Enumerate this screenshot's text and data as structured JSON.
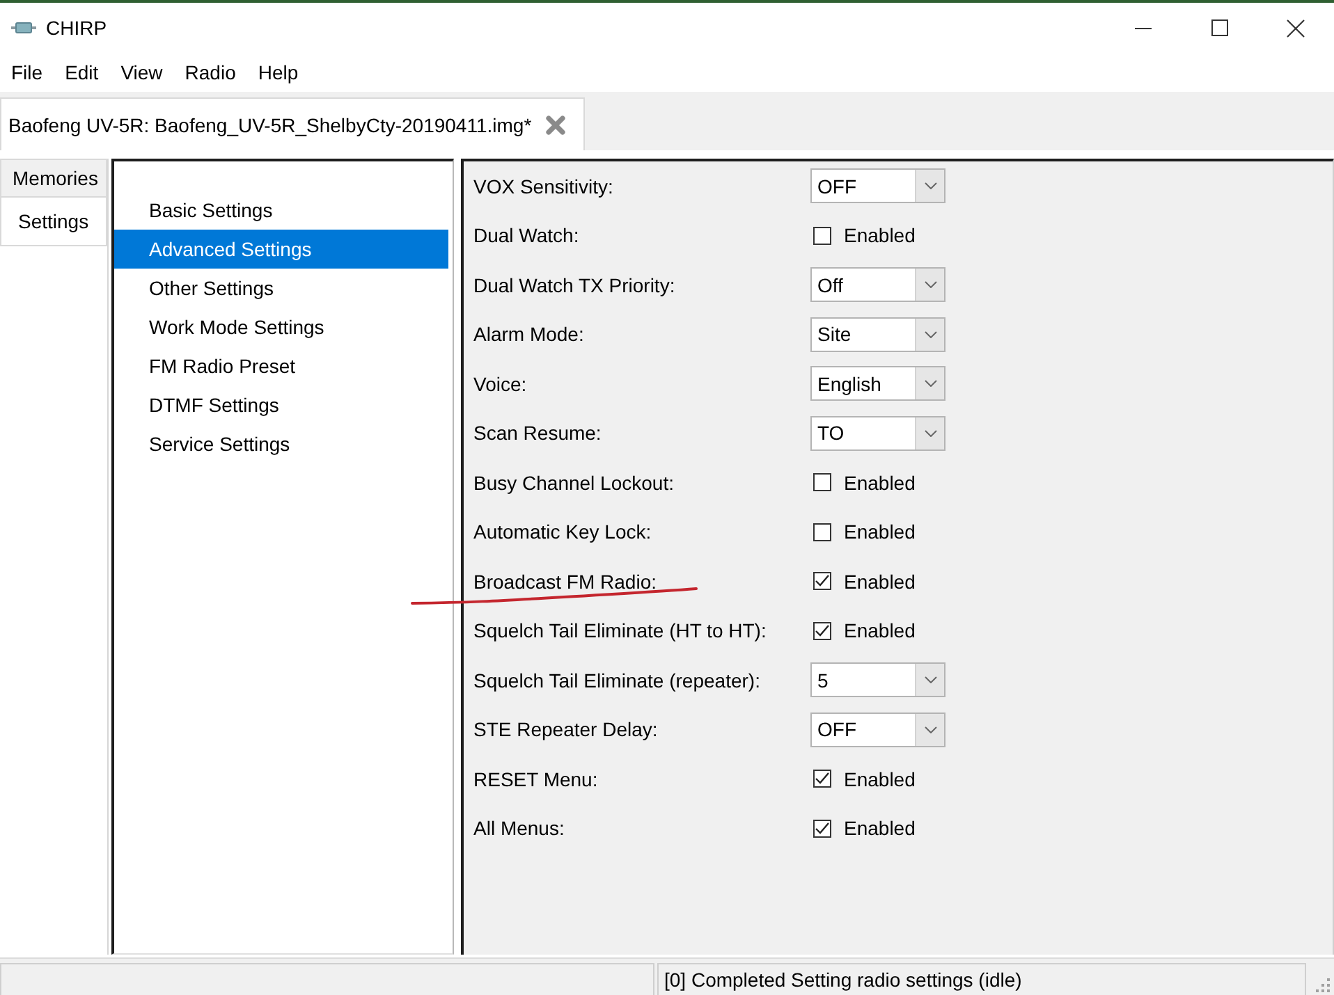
{
  "window": {
    "title": "CHIRP"
  },
  "menu": [
    "File",
    "Edit",
    "View",
    "Radio",
    "Help"
  ],
  "document_tab": {
    "label": "Baofeng UV-5R: Baofeng_UV-5R_ShelbyCty-20190411.img*"
  },
  "side_tabs": [
    {
      "label": "Memories",
      "selected": false
    },
    {
      "label": "Settings",
      "selected": true
    }
  ],
  "settings_groups": [
    {
      "label": "Basic Settings",
      "selected": false
    },
    {
      "label": "Advanced Settings",
      "selected": true
    },
    {
      "label": "Other Settings",
      "selected": false
    },
    {
      "label": "Work Mode Settings",
      "selected": false
    },
    {
      "label": "FM Radio Preset",
      "selected": false
    },
    {
      "label": "DTMF Settings",
      "selected": false
    },
    {
      "label": "Service Settings",
      "selected": false
    }
  ],
  "settings": [
    {
      "kind": "combo",
      "label": "VOX Sensitivity:",
      "value": "OFF",
      "underlined": false
    },
    {
      "kind": "checkbox",
      "label": "Dual Watch:",
      "text": "Enabled",
      "checked": false,
      "underlined": false
    },
    {
      "kind": "combo",
      "label": "Dual Watch TX Priority:",
      "value": "Off",
      "underlined": false
    },
    {
      "kind": "combo",
      "label": "Alarm Mode:",
      "value": "Site",
      "underlined": false
    },
    {
      "kind": "combo",
      "label": "Voice:",
      "value": "English",
      "underlined": false
    },
    {
      "kind": "combo",
      "label": "Scan Resume:",
      "value": "TO",
      "underlined": false
    },
    {
      "kind": "checkbox",
      "label": "Busy Channel Lockout:",
      "text": "Enabled",
      "checked": false,
      "underlined": false
    },
    {
      "kind": "checkbox",
      "label": "Automatic Key Lock:",
      "text": "Enabled",
      "checked": false,
      "underlined": false
    },
    {
      "kind": "checkbox",
      "label": "Broadcast FM Radio:",
      "text": "Enabled",
      "checked": true,
      "underlined": true
    },
    {
      "kind": "checkbox",
      "label": "Squelch Tail Eliminate (HT to HT):",
      "text": "Enabled",
      "checked": true,
      "underlined": false
    },
    {
      "kind": "combo",
      "label": "Squelch Tail Eliminate (repeater):",
      "value": "5",
      "underlined": false
    },
    {
      "kind": "combo",
      "label": "STE Repeater Delay:",
      "value": "OFF",
      "underlined": false
    },
    {
      "kind": "checkbox",
      "label": "RESET Menu:",
      "text": "Enabled",
      "checked": true,
      "underlined": false
    },
    {
      "kind": "checkbox",
      "label": "All Menus:",
      "text": "Enabled",
      "checked": true,
      "underlined": false
    }
  ],
  "status_bar": {
    "text": "[0] Completed Setting radio settings (idle)"
  }
}
